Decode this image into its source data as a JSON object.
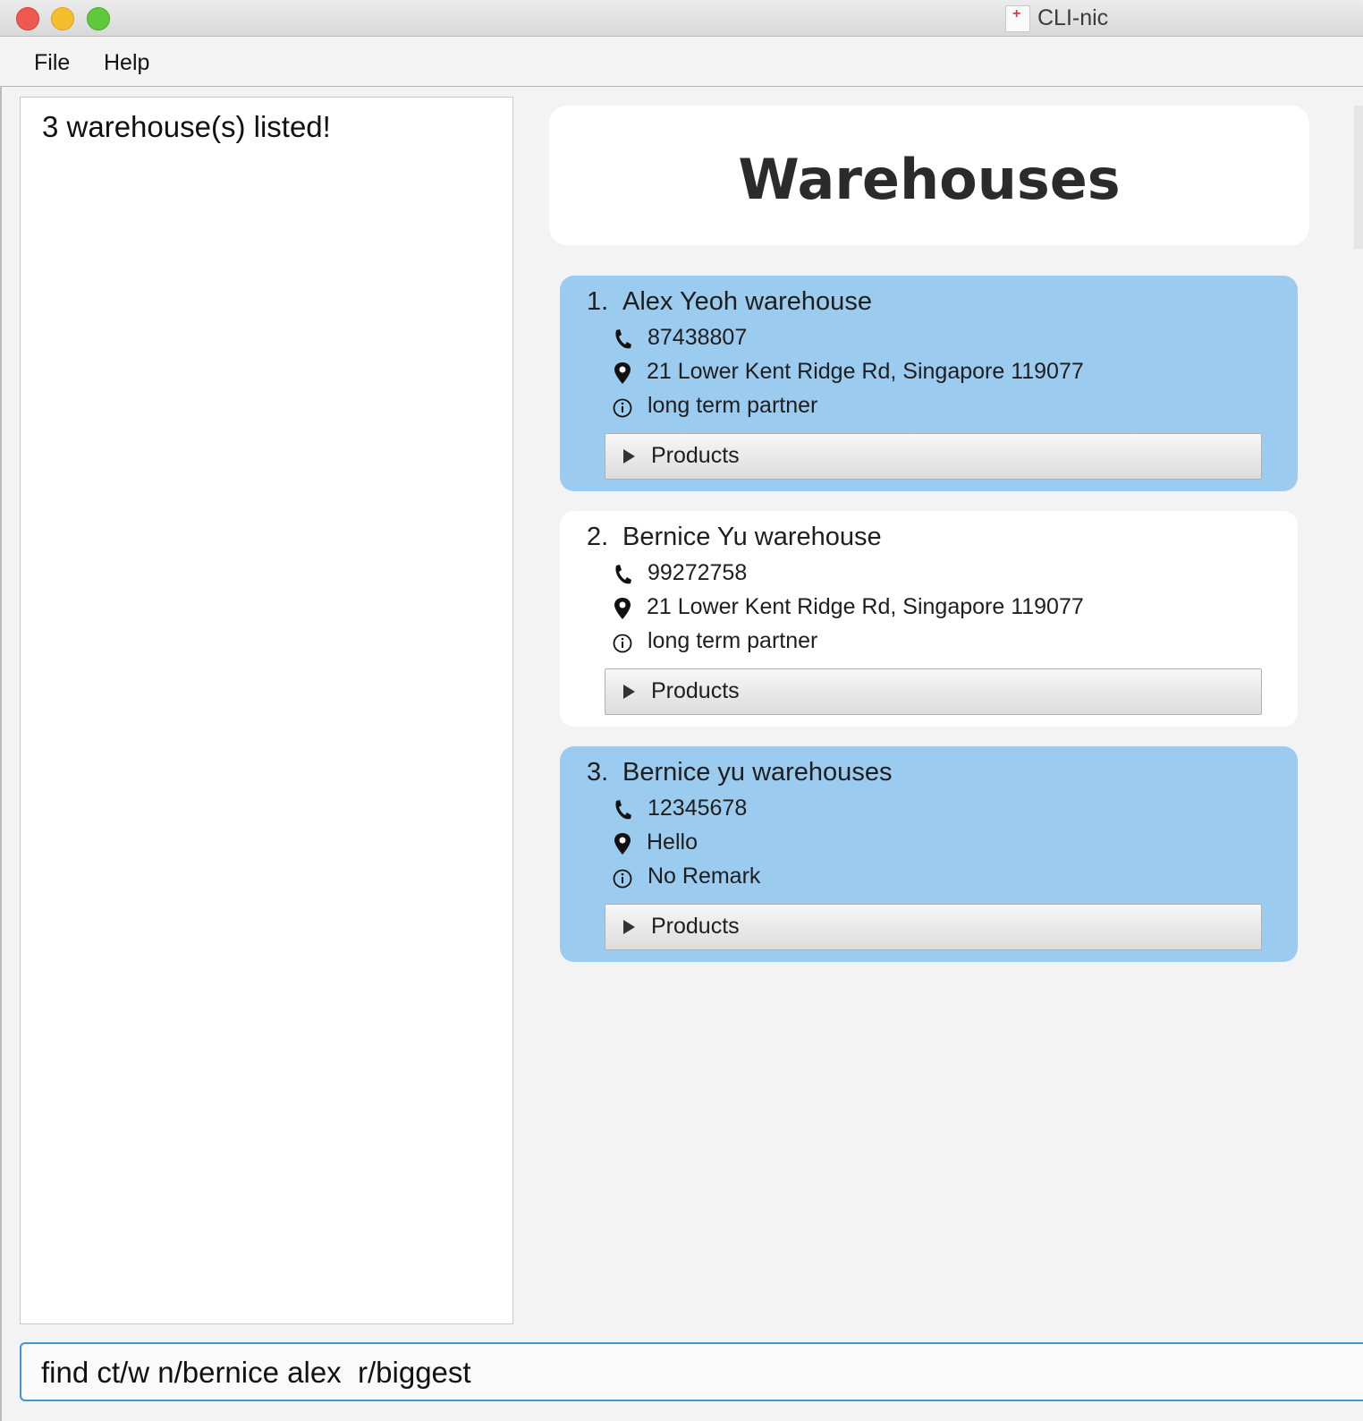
{
  "window": {
    "title": "CLI-nic"
  },
  "menu": {
    "file": "File",
    "help": "Help"
  },
  "result": {
    "message": "3 warehouse(s) listed!"
  },
  "header": {
    "title": "Warehouses"
  },
  "warehouses": [
    {
      "index": "1.",
      "name": "Alex Yeoh warehouse",
      "phone": "87438807",
      "address": "21 Lower Kent Ridge Rd, Singapore 119077",
      "remark": "long term partner",
      "products_label": "Products",
      "highlight": "#9ccbf0"
    },
    {
      "index": "2.",
      "name": "Bernice Yu warehouse",
      "phone": "99272758",
      "address": "21 Lower Kent Ridge Rd, Singapore 119077",
      "remark": "long term partner",
      "products_label": "Products",
      "highlight": "#ffffff"
    },
    {
      "index": "3.",
      "name": "Bernice yu warehouses",
      "phone": "12345678",
      "address": "Hello",
      "remark": "No Remark",
      "products_label": "Products",
      "highlight": "#9ccbf0"
    }
  ],
  "command": {
    "value": "find ct/w n/bernice alex  r/biggest"
  },
  "icons": {
    "phone": "phone-icon",
    "address": "location-pin-icon",
    "remark": "info-icon",
    "expand": "triangle-right-icon"
  }
}
